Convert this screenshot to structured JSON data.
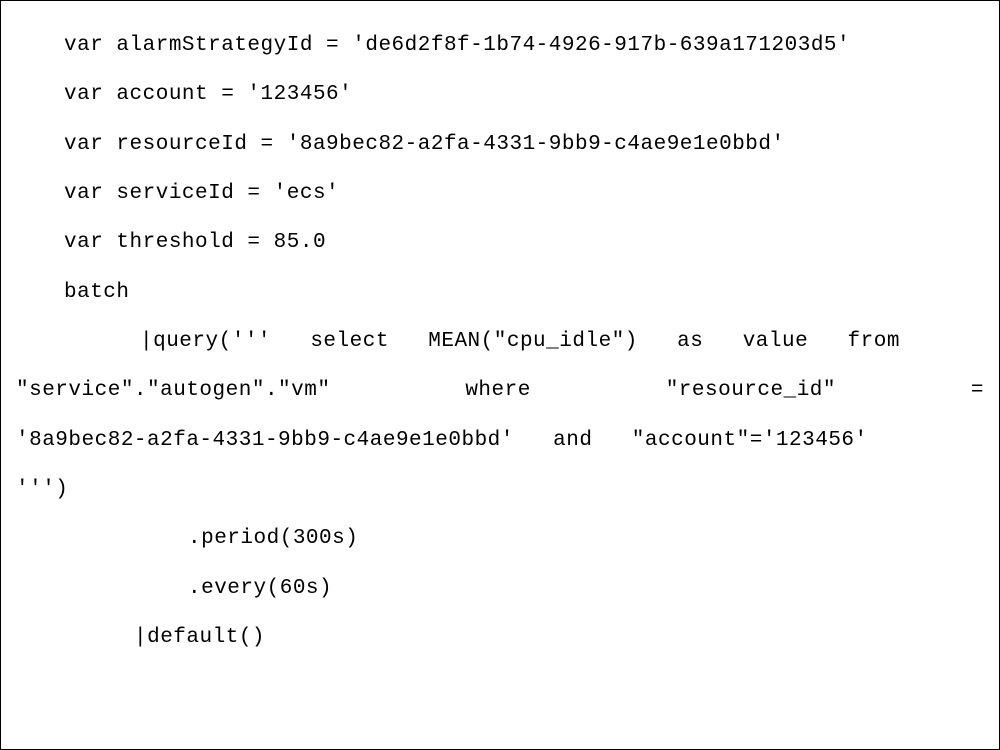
{
  "code": {
    "l1": "var alarmStrategyId = 'de6d2f8f-1b74-4926-917b-639a171203d5'",
    "l2": "var account = '123456'",
    "l3": "var resourceId = '8a9bec82-a2fa-4331-9bb9-c4ae9e1e0bbd'",
    "l4": "var serviceId = 'ecs'",
    "l5": "var threshold = 85.0",
    "l6": "batch",
    "q1a": "|query('''   select   MEAN(\"cpu_idle\")   as   value   from",
    "q2a": "\"service\".\"autogen\".\"vm\"",
    "q2b": "where",
    "q2c": "\"resource_id\"",
    "q2d": "=",
    "q3": "'8a9bec82-a2fa-4331-9bb9-c4ae9e1e0bbd'   and   \"account\"='123456'",
    "q4": "''')",
    "l7": ".period(300s)",
    "l8": ".every(60s)",
    "l9": "|default()"
  }
}
